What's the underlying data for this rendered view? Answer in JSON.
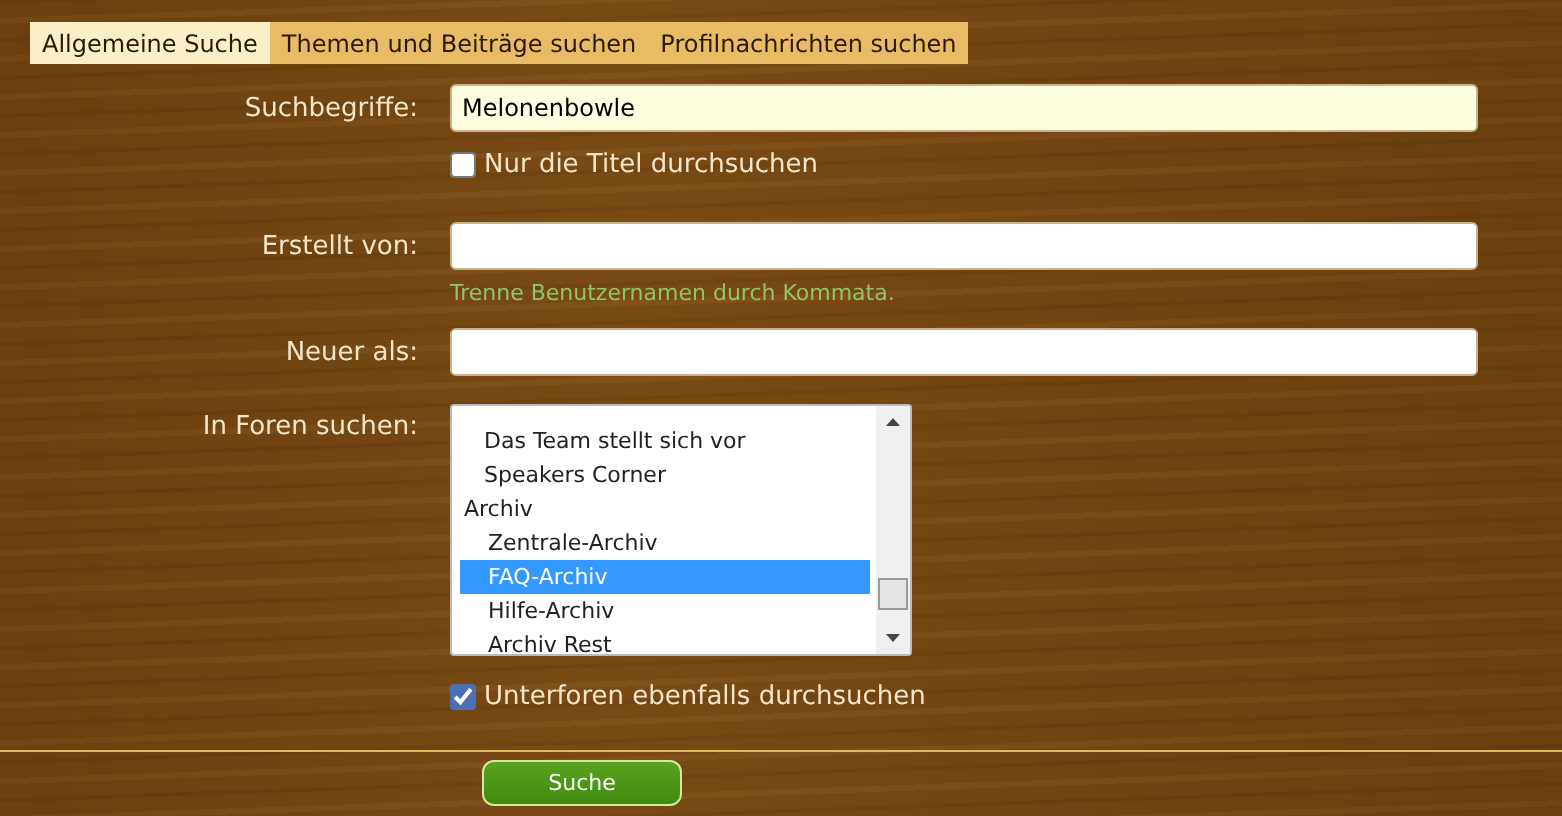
{
  "tabs": [
    {
      "label": "Allgemeine Suche",
      "selected": true
    },
    {
      "label": "Themen und Beiträge suchen",
      "selected": false
    },
    {
      "label": "Profilnachrichten suchen",
      "selected": false
    }
  ],
  "search_terms": {
    "label": "Suchbegriffe:",
    "value": "Melonenbowle"
  },
  "titles_only": {
    "label": "Nur die Titel durchsuchen",
    "checked": false
  },
  "created_by": {
    "label": "Erstellt von:",
    "hint": "Trenne Benutzernamen durch Kommata."
  },
  "newer_than": {
    "label": "Neuer als:"
  },
  "forums": {
    "label": "In Foren suchen:",
    "items": [
      {
        "label": "Das Team stellt sich vor",
        "selected": false
      },
      {
        "label": "Speakers Corner",
        "selected": false
      },
      {
        "label": "Archiv",
        "selected": false,
        "children": [
          {
            "label": "Zentrale-Archiv",
            "selected": false
          },
          {
            "label": "FAQ-Archiv",
            "selected": true
          },
          {
            "label": "Hilfe-Archiv",
            "selected": false
          },
          {
            "label": "Archiv Rest",
            "selected": false
          }
        ]
      }
    ]
  },
  "subforums": {
    "label": "Unterforen ebenfalls durchsuchen",
    "checked": true
  },
  "submit": {
    "label": "Suche"
  }
}
